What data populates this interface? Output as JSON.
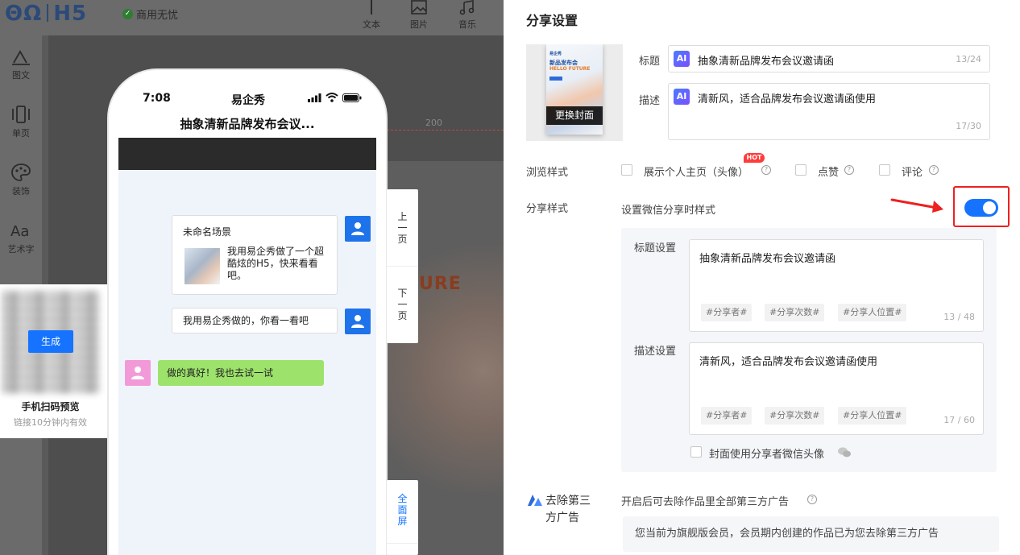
{
  "editor": {
    "logo": "H5",
    "badge": "商用无忧",
    "tools": [
      {
        "icon": "text-tool-icon",
        "label": "文本"
      },
      {
        "icon": "image-tool-icon",
        "label": "图片"
      },
      {
        "icon": "music-tool-icon",
        "label": "音乐"
      }
    ],
    "sidebar": [
      {
        "icon": "text-icon",
        "label": "图文"
      },
      {
        "icon": "page-icon",
        "label": "单页"
      },
      {
        "icon": "palette-icon",
        "label": "装饰"
      },
      {
        "icon": "art-text-icon",
        "label": "艺术字"
      }
    ],
    "ruler_mark": "200",
    "artwork_text": "URE",
    "qr": {
      "button": "生成",
      "title": "手机扫码预览",
      "subtitle": "链接10分钟内有效"
    }
  },
  "phone": {
    "time": "7:08",
    "carrier": "易企秀",
    "page_title": "抽象清新品牌发布会议...",
    "messages": [
      {
        "type": "card",
        "title": "未命名场景",
        "text": "我用易企秀做了一个超酷炫的H5，快来看看吧。"
      },
      {
        "type": "text",
        "text": "我用易企秀做的，你看一看吧"
      },
      {
        "type": "reply",
        "text": "做的真好！我也去试一试"
      }
    ],
    "nav": {
      "prev": "上一页",
      "next": "下一页",
      "fullscreen": "全面屏"
    }
  },
  "share": {
    "heading": "分享设置",
    "cover_button": "更换封面",
    "cover_art": {
      "brand": "易企秀",
      "title": "新品发布会",
      "tagline": "HELLO FUTURE"
    },
    "title_label": "标题",
    "title_value": "抽象清新品牌发布会议邀请函",
    "title_count": "13/24",
    "desc_label": "描述",
    "desc_value": "清新风，适合品牌发布会议邀请函使用",
    "desc_count": "17/30",
    "ai_label": "AI",
    "browse_label": "浏览样式",
    "browse_options": [
      {
        "label": "展示个人主页（头像）",
        "checked": false
      },
      {
        "label": "点赞",
        "checked": false
      },
      {
        "label": "评论",
        "checked": false
      }
    ],
    "hot_badge": "HOT",
    "style_label": "分享样式",
    "wechat_label": "设置微信分享时样式",
    "wechat_enabled": true,
    "title_setting_label": "标题设置",
    "title_setting_value": "抽象清新品牌发布会议邀请函",
    "title_setting_count": "13 / 48",
    "desc_setting_label": "描述设置",
    "desc_setting_value": "清新风，适合品牌发布会议邀请函使用",
    "desc_setting_count": "17 / 60",
    "tags": [
      "#分享者#",
      "#分享次数#",
      "#分享人位置#"
    ],
    "cover_avatar_label": "封面使用分享者微信头像",
    "ad_label": "去除第三方广告",
    "ad_desc": "开启后可去除作品里全部第三方广告",
    "ad_notice": "您当前为旗舰版会员，会员期内创建的作品已为您去除第三方广告",
    "accent_color": "#1673ff",
    "highlight_color": "#ee2020"
  }
}
